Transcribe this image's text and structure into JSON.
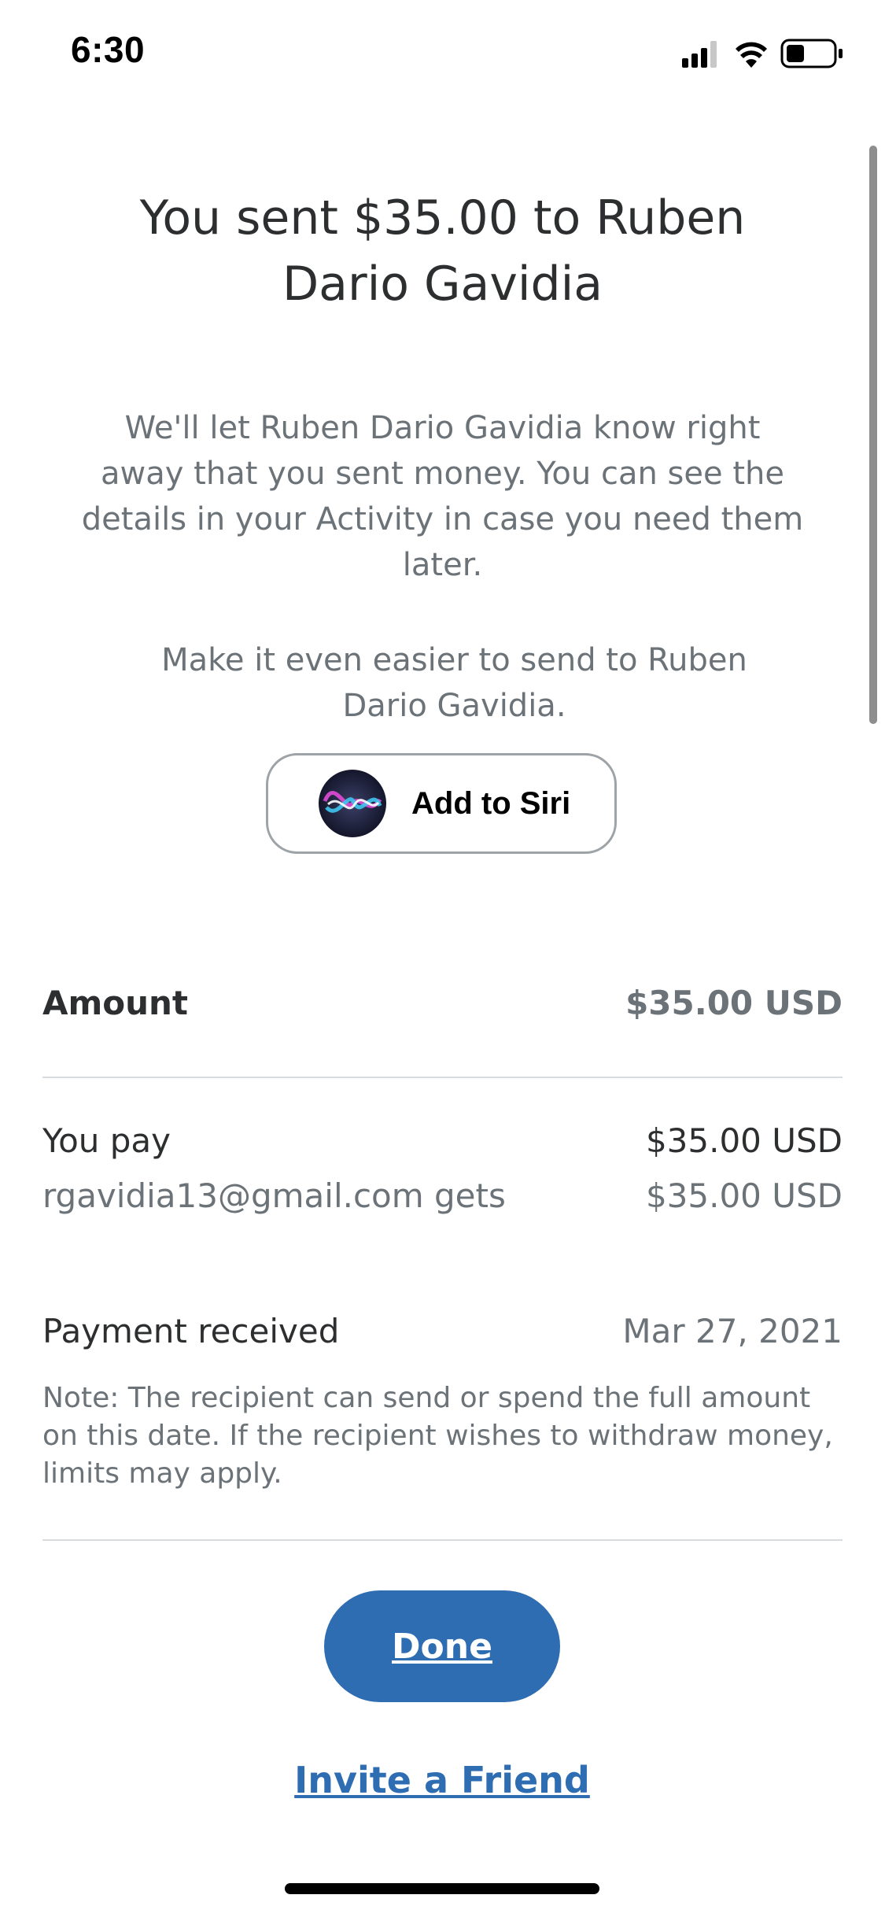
{
  "status_bar": {
    "time": "6:30",
    "icons": [
      "cellular-signal-icon",
      "wifi-icon",
      "battery-icon"
    ]
  },
  "confirmation": {
    "title": "You sent $35.00 to Ruben Dario Gavidia",
    "message": "We'll let Ruben Dario Gavidia know right away that you sent money. You can see the details in your Activity in case you need them later.",
    "siri_prompt": "Make it even easier to send to Ruben Dario Gavidia.",
    "siri_button_label": "Add to Siri"
  },
  "details": {
    "amount_label": "Amount",
    "amount_value": "$35.00 USD",
    "you_pay_label": "You pay",
    "you_pay_value": "$35.00 USD",
    "recipient_gets_label": "rgavidia13@gmail.com gets",
    "recipient_gets_value": "$35.00 USD",
    "payment_received_label": "Payment received",
    "payment_received_date": "Mar 27, 2021",
    "note": "Note: The recipient can send or spend the full amount on this date. If the recipient wishes to withdraw money, limits may apply."
  },
  "actions": {
    "done_label": "Done",
    "invite_label": "Invite a Friend"
  },
  "colors": {
    "primary_blue": "#2f6db3",
    "text_dark": "#2c2e2f",
    "text_gray": "#6c7378",
    "divider": "#d9dcde"
  }
}
